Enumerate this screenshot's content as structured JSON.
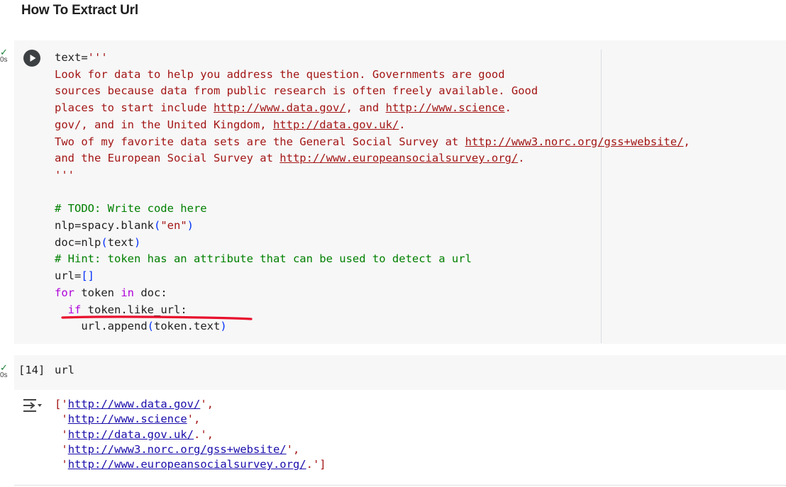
{
  "page": {
    "heading": "How To Extract Url"
  },
  "cell1": {
    "status": {
      "time": "0s"
    },
    "code": {
      "l1_a": "text=",
      "l1_b": "'''",
      "l2": "Look for data to help you address the question. Governments are good",
      "l3": "sources because data from public research is often freely available. Good",
      "l4_a": "places to start include ",
      "l4_url1": "http://www.data.gov/",
      "l4_b": ", and ",
      "l4_url2": "http://www.science",
      "l4_c": ".",
      "l5_a": "gov/, and in the United Kingdom, ",
      "l5_url": "http://data.gov.uk/",
      "l5_b": ".",
      "l6_a": "Two of my favorite data sets are the General Social Survey at ",
      "l6_url": "http://www3.norc.org/gss+website/",
      "l6_b": ",",
      "l7_a": "and the European Social Survey at ",
      "l7_url": "http://www.europeansocialsurvey.org/",
      "l7_b": ".",
      "l8": "'''",
      "l10": "# TODO: Write code here",
      "l11_a": "nlp=spacy.blank",
      "l11_b": "(",
      "l11_c": "\"en\"",
      "l11_d": ")",
      "l12_a": "doc=nlp",
      "l12_b": "(",
      "l12_c": "text",
      "l12_d": ")",
      "l13": "# Hint: token has an attribute that can be used to detect a url",
      "l14_a": "url=",
      "l14_b": "[]",
      "l15_kw1": "for",
      "l15_a": " token ",
      "l15_kw2": "in",
      "l15_b": " doc:",
      "l16_kw": "if",
      "l16_a": " token.like_url:",
      "l17_a": "url.append",
      "l17_b": "(",
      "l17_c": "token.text",
      "l17_d": ")"
    }
  },
  "cell2": {
    "status": {
      "time": "0s"
    },
    "exec_count": "[14]",
    "code": "url"
  },
  "output": {
    "lines": [
      {
        "pre": "['",
        "url": "http://www.data.gov/",
        "post": "',",
        "indent": ""
      },
      {
        "pre": "'",
        "url": "http://www.science",
        "post": "',",
        "indent": " "
      },
      {
        "pre": "'",
        "url": "http://data.gov.uk/",
        "post": ".',",
        "indent": " "
      },
      {
        "pre": "'",
        "url": "http://www3.norc.org/gss+website/",
        "post": "',",
        "indent": " "
      },
      {
        "pre": "'",
        "url": "http://www.europeansocialsurvey.org/",
        "post": ".']",
        "indent": " "
      }
    ]
  },
  "icons": {
    "run": "play-circle-icon",
    "status_ok": "checkmark-icon",
    "output_actions": "output-menu-icon"
  },
  "colors": {
    "string": "#a31515",
    "comment": "#008000",
    "keyword": "#af00db",
    "bracket": "#0431fa",
    "link": "#1a0dab",
    "annotation_underline": "#e8112d",
    "cell_background": "#f7f7f7"
  }
}
